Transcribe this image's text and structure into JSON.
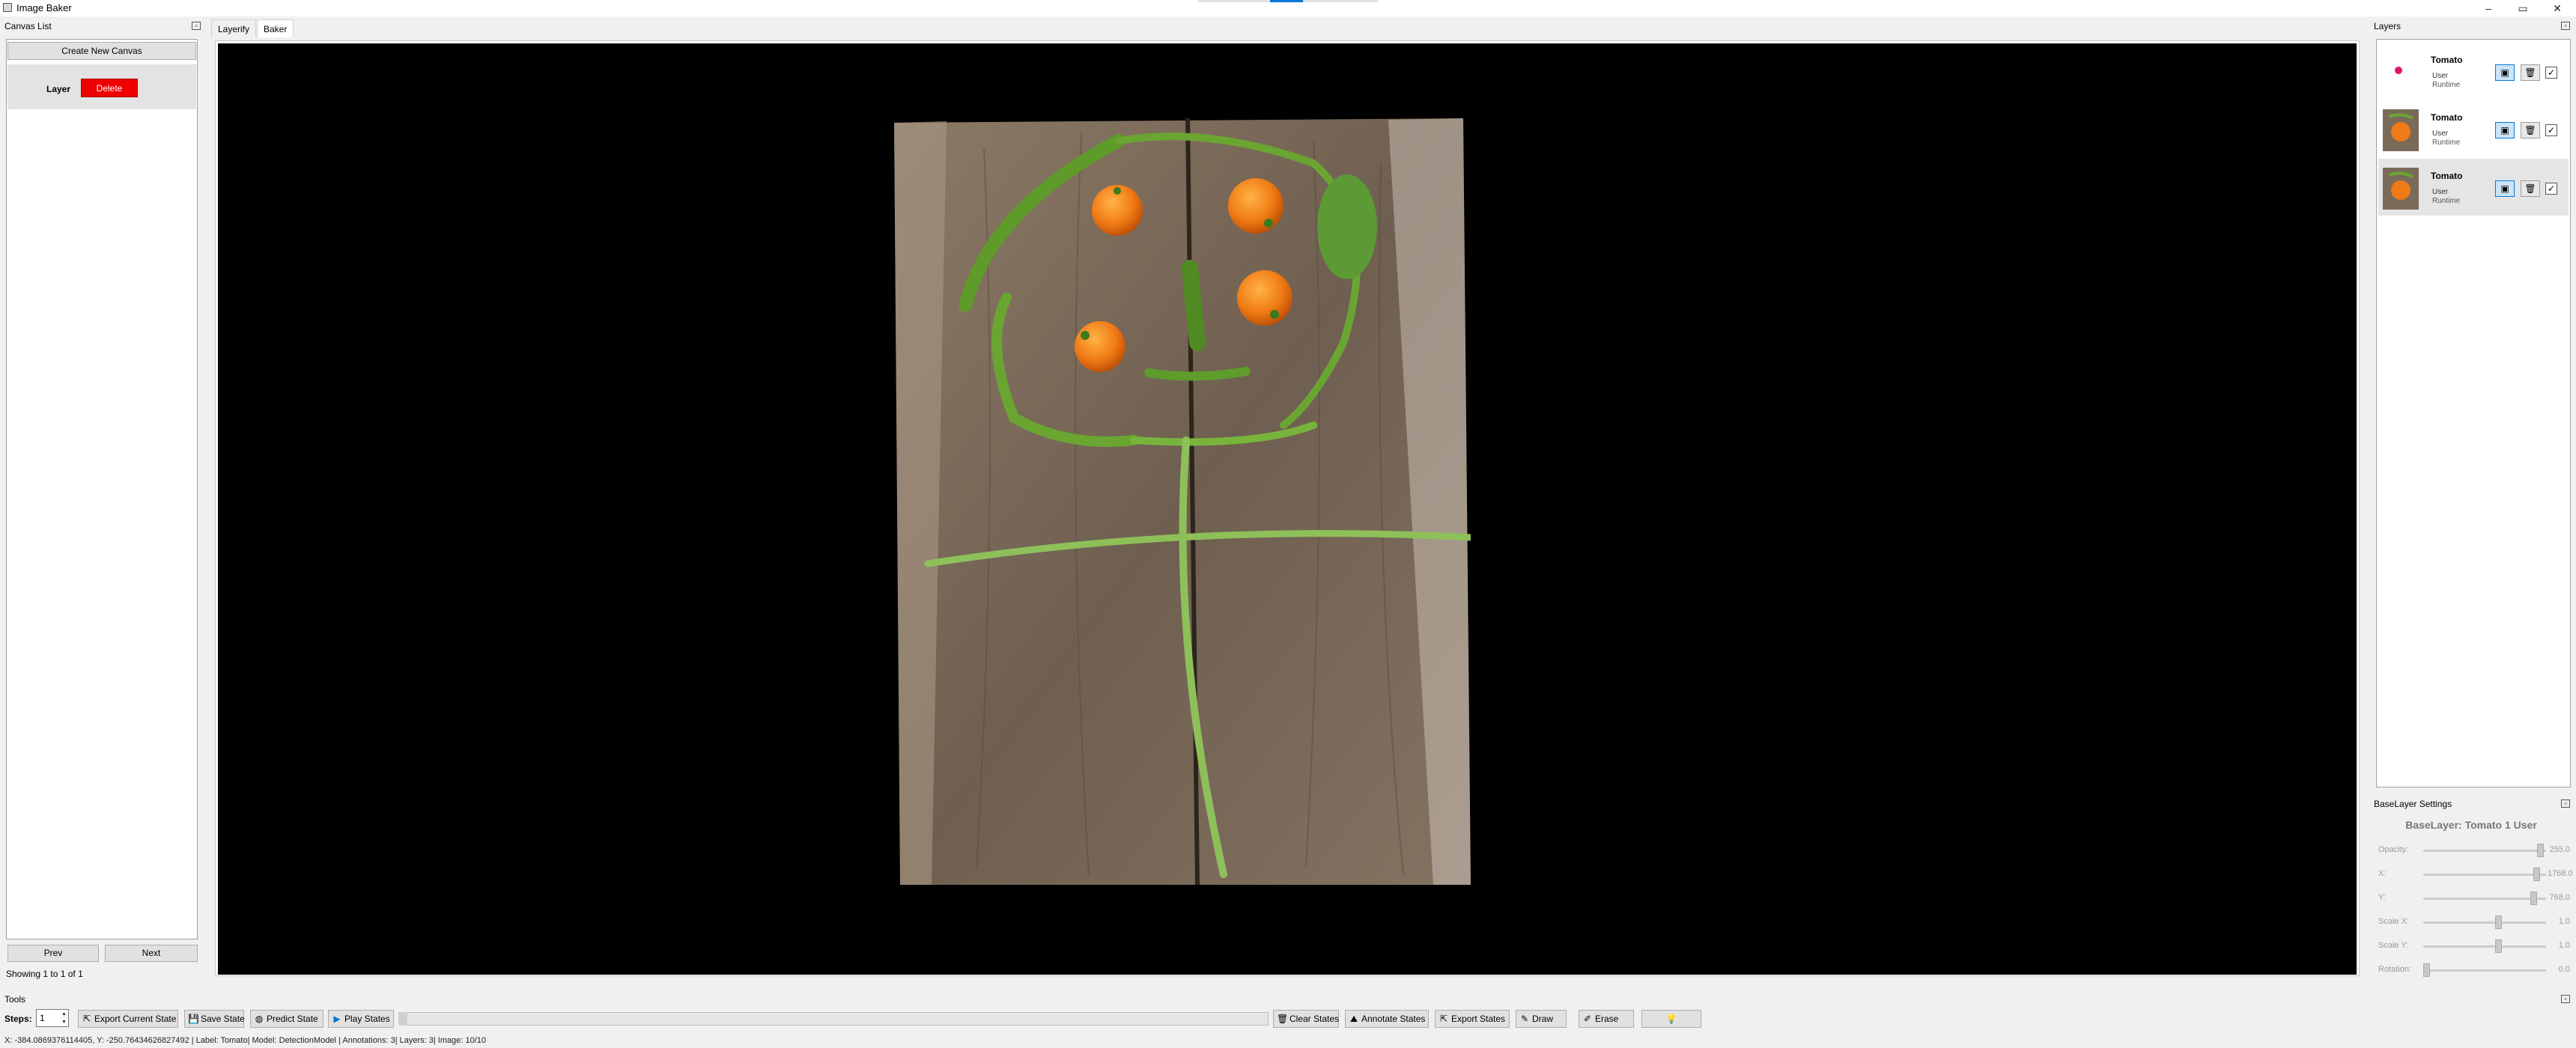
{
  "window": {
    "title": "Image Baker",
    "minimize": "–",
    "maximize": "▭",
    "close": "✕"
  },
  "canvas_list": {
    "header": "Canvas List",
    "create_button": "Create New Canvas",
    "layer_label": "Layer",
    "delete_button": "Delete",
    "prev_button": "Prev",
    "next_button": "Next",
    "showing": "Showing 1 to 1 of 1"
  },
  "tabs": [
    {
      "label": "Layerify"
    },
    {
      "label": "Baker"
    }
  ],
  "layers": {
    "header": "Layers",
    "items": [
      {
        "name": "Tomato",
        "subtitle": "User",
        "runtime": "Runtime",
        "thumb": "pink-dot",
        "selected": false
      },
      {
        "name": "Tomato",
        "subtitle": "User",
        "runtime": "Runtime",
        "thumb": "tomato-photo",
        "selected": false
      },
      {
        "name": "Tomato",
        "subtitle": "User",
        "runtime": "Runtime",
        "thumb": "tomato-photo",
        "selected": true
      }
    ]
  },
  "base_layer_settings": {
    "header": "BaseLayer Settings",
    "title": "BaseLayer: Tomato 1 User",
    "sliders": [
      {
        "label": "Opacity:",
        "value": "255.0",
        "level": 0.98
      },
      {
        "label": "X:",
        "value": "1768.0",
        "level": 0.95
      },
      {
        "label": "Y:",
        "value": "768.0",
        "level": 0.92
      },
      {
        "label": "Scale X:",
        "value": "1.0",
        "level": 0.62
      },
      {
        "label": "Scale Y:",
        "value": "1.0",
        "level": 0.62
      },
      {
        "label": "Rotation:",
        "value": "0.0",
        "level": 0.0
      }
    ]
  },
  "tools": {
    "header": "Tools",
    "steps_label": "Steps:",
    "steps_value": "1",
    "export_current": "Export Current State",
    "save_state": "Save State",
    "predict_state": "Predict State",
    "play_states": "Play States",
    "clear_states": "Clear States",
    "annotate_states": "Annotate States",
    "export_states": "Export States",
    "draw": "Draw",
    "erase": "Erase",
    "progress": 0.01
  },
  "status_bar": "X: -384.0869376114405, Y: -250.76434626827492 | Label: Tomato| Model: DetectionModel | Annotations: 3| Layers: 3| Image: 10/10",
  "colors": {
    "accent": "#0078d7",
    "delete": "#ee0000",
    "canvas_bg": "#000000"
  }
}
